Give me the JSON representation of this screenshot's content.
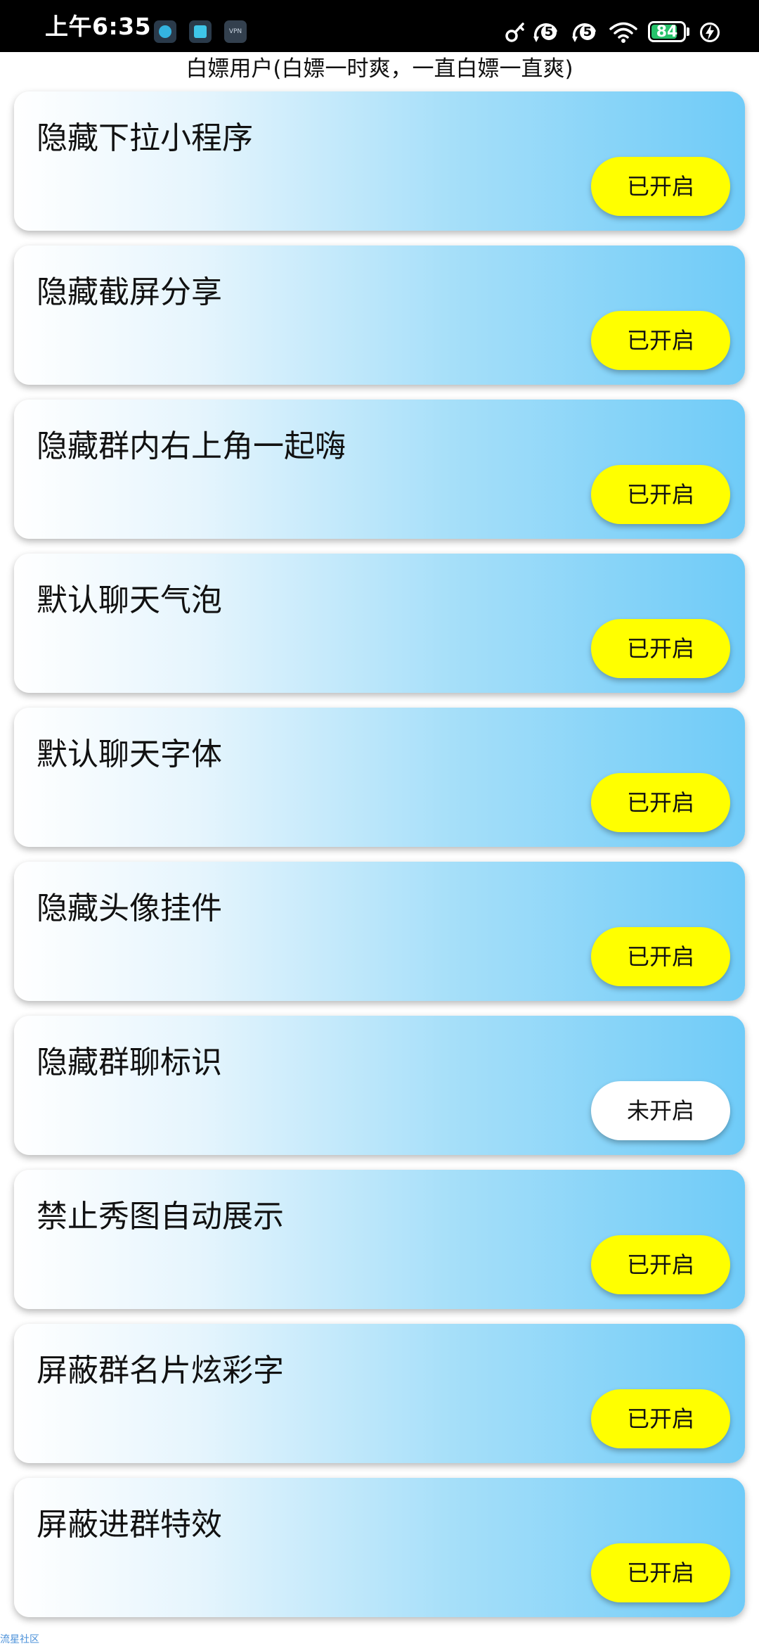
{
  "status_bar": {
    "time": "上午6:35",
    "notification_icons": [
      "compass-app-icon",
      "screen-app-icon",
      "vpn-icon"
    ],
    "vpn_label": "VPN",
    "right_icons": [
      "key-icon",
      "sim1-5g-icon",
      "sim2-5g-icon",
      "wifi-icon",
      "battery-icon",
      "charging-icon"
    ],
    "sim_badge": "5",
    "battery_level": "84",
    "battery_color": "#27c26b"
  },
  "header": {
    "user_title": "白嫖用户(白嫖一时爽，一直白嫖一直爽)"
  },
  "colors": {
    "enabled_button": "#ffff00",
    "disabled_button": "#ffffff",
    "card_gradient_end": "#6fcbf8"
  },
  "settings": [
    {
      "label": "隐藏下拉小程序",
      "status": "已开启",
      "enabled": true
    },
    {
      "label": "隐藏截屏分享",
      "status": "已开启",
      "enabled": true
    },
    {
      "label": "隐藏群内右上角一起嗨",
      "status": "已开启",
      "enabled": true
    },
    {
      "label": "默认聊天气泡",
      "status": "已开启",
      "enabled": true
    },
    {
      "label": "默认聊天字体",
      "status": "已开启",
      "enabled": true
    },
    {
      "label": "隐藏头像挂件",
      "status": "已开启",
      "enabled": true
    },
    {
      "label": "隐藏群聊标识",
      "status": "未开启",
      "enabled": false
    },
    {
      "label": "禁止秀图自动展示",
      "status": "已开启",
      "enabled": true
    },
    {
      "label": "屏蔽群名片炫彩字",
      "status": "已开启",
      "enabled": true
    },
    {
      "label": "屏蔽进群特效",
      "status": "已开启",
      "enabled": true
    }
  ],
  "watermark": "流星社区"
}
